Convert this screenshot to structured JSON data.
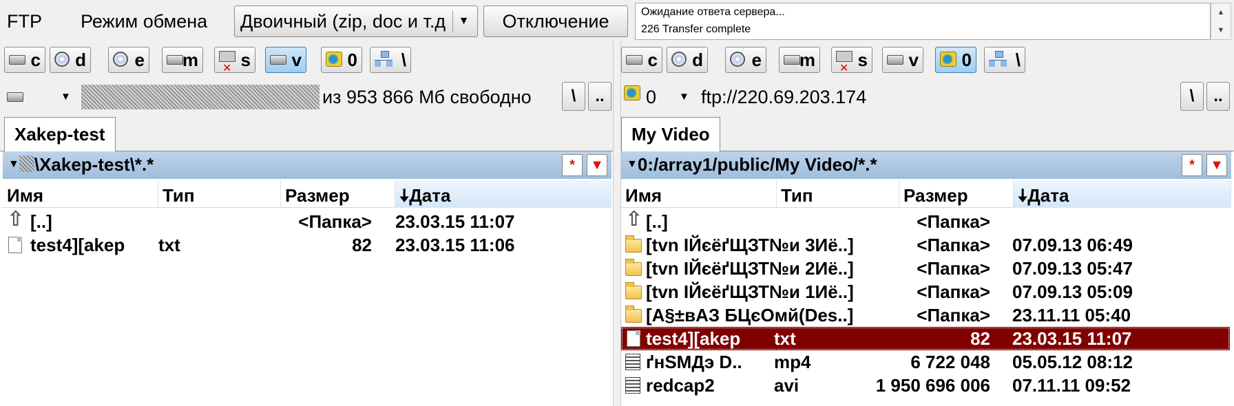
{
  "toolbar": {
    "ftp_label": "FTP",
    "mode_label": "Режим обмена",
    "mode_value": "Двоичный (zip, doc и т.д.)",
    "disconnect_label": "Отключение",
    "log_lines": [
      "Ожидание ответа сервера...",
      "226 Transfer complete"
    ]
  },
  "left": {
    "drives": [
      {
        "icon": "hdd-icon",
        "label": "c"
      },
      {
        "icon": "cd-icon",
        "label": "d"
      },
      {
        "icon": "cd-icon",
        "label": "e"
      },
      {
        "icon": "hdd-icon",
        "label": "m"
      },
      {
        "icon": "network-drive-disconnected-icon",
        "label": "s"
      },
      {
        "icon": "hdd-icon",
        "label": "v",
        "selected": true
      },
      {
        "icon": "ftp-icon",
        "label": "0"
      },
      {
        "icon": "network-tree-icon",
        "label": "\\"
      }
    ],
    "free_space": "из 953 866 Мб свободно",
    "root_btn": "\\",
    "up_btn": "..",
    "tab": "Xakep-test",
    "path": "\\Xakep-test\\*.*",
    "columns": {
      "name": "Имя",
      "type": "Тип",
      "size": "Размер",
      "date": "Дата"
    },
    "files": [
      {
        "icon": "up-icon",
        "name": "[..]",
        "type": "",
        "size": "<Папка>",
        "date": "23.03.15 11:07"
      },
      {
        "icon": "file-icon",
        "name": "test4][akep",
        "type": "txt",
        "size": "82",
        "date": "23.03.15 11:06"
      }
    ]
  },
  "right": {
    "drives": [
      {
        "icon": "hdd-icon",
        "label": "c"
      },
      {
        "icon": "cd-icon",
        "label": "d"
      },
      {
        "icon": "cd-icon",
        "label": "e"
      },
      {
        "icon": "hdd-icon",
        "label": "m"
      },
      {
        "icon": "network-drive-disconnected-icon",
        "label": "s"
      },
      {
        "icon": "hdd-icon",
        "label": "v"
      },
      {
        "icon": "ftp-icon",
        "label": "0",
        "selected": true
      },
      {
        "icon": "network-tree-icon",
        "label": "\\"
      }
    ],
    "drive_combo": "0",
    "address": "ftp://220.69.203.174",
    "root_btn": "\\",
    "up_btn": "..",
    "tab": "My Video",
    "path": "0:/array1/public/My Video/*.*",
    "columns": {
      "name": "Имя",
      "type": "Тип",
      "size": "Размер",
      "date": "Дата"
    },
    "files": [
      {
        "icon": "up-icon",
        "name": "[..]",
        "type": "",
        "size": "<Папка>",
        "date": ""
      },
      {
        "icon": "folder-icon",
        "name": "[tvn ІЙєёґЩЗТ№и 3Иё..]",
        "type": "",
        "size": "<Папка>",
        "date": "07.09.13 06:49"
      },
      {
        "icon": "folder-icon",
        "name": "[tvn ІЙєёґЩЗТ№и 2Иё..]",
        "type": "",
        "size": "<Папка>",
        "date": "07.09.13 05:47"
      },
      {
        "icon": "folder-icon",
        "name": "[tvn ІЙєёґЩЗТ№и 1Иё..]",
        "type": "",
        "size": "<Папка>",
        "date": "07.09.13 05:09"
      },
      {
        "icon": "folder-icon",
        "name": "[A§±вАЗ БЦєОмй(Des..]",
        "type": "",
        "size": "<Папка>",
        "date": "23.11.11 05:40"
      },
      {
        "icon": "file-icon",
        "name": "test4][akep",
        "type": "txt",
        "size": "82",
        "date": "23.03.15 11:07",
        "selected": true
      },
      {
        "icon": "media-file-icon",
        "name": "ґнSMДэ D..",
        "type": "mp4",
        "size": "6 722 048",
        "date": "05.05.12 08:12"
      },
      {
        "icon": "media-file-icon",
        "name": "redcap2",
        "type": "avi",
        "size": "1 950 696 006",
        "date": "07.11.11 09:52"
      }
    ]
  }
}
